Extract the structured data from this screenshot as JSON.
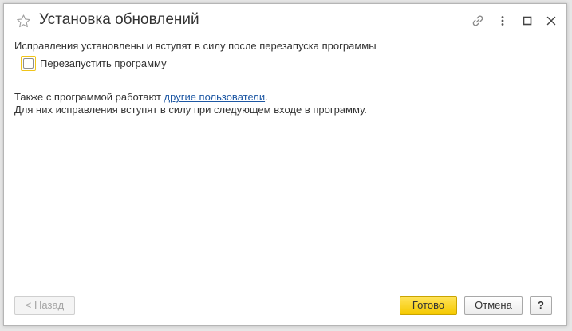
{
  "window": {
    "title": "Установка обновлений",
    "icons": {
      "favorite": "star-icon",
      "link": "link-icon",
      "more": "more-vertical-icon",
      "maximize": "maximize-icon",
      "close": "close-icon"
    }
  },
  "content": {
    "message": "Исправления установлены и вступят в силу после перезапуска программы",
    "restart_checkbox": {
      "label": "Перезапустить программу",
      "checked": false
    },
    "info_line1_prefix": "Также с программой работают ",
    "info_line1_link": "другие пользователи",
    "info_line1_suffix": ".",
    "info_line2": "Для них исправления вступят в силу при следующем входе в программу."
  },
  "footer": {
    "back_label": "< Назад",
    "done_label": "Готово",
    "cancel_label": "Отмена",
    "help_label": "?"
  },
  "colors": {
    "primary_button": "#f5c900",
    "link": "#1d57a3",
    "focus_frame": "#f0c419"
  }
}
